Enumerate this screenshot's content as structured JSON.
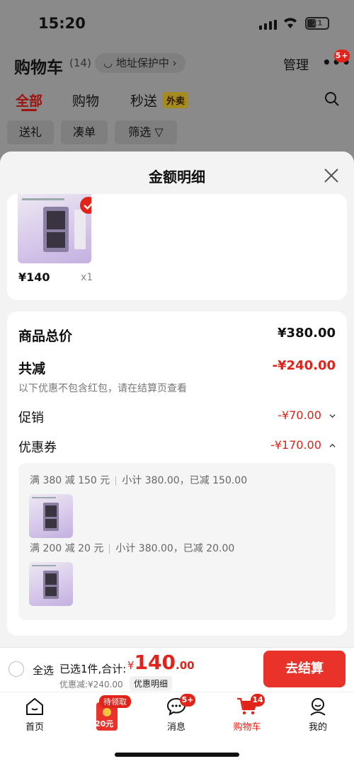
{
  "status_bar": {
    "time": "15:20",
    "battery": "21"
  },
  "header": {
    "title": "购物车",
    "count": "(14)",
    "address_protect": "地址保护中",
    "manage": "管理",
    "more_badge": "5+"
  },
  "tabs": [
    {
      "label": "全部"
    },
    {
      "label": "购物"
    },
    {
      "label": "秒送"
    }
  ],
  "waimai_tag": "外卖",
  "chips": [
    {
      "label": "送礼"
    },
    {
      "label": "凑单"
    },
    {
      "label": "筛选"
    }
  ],
  "sheet": {
    "title": "金额明细",
    "product": {
      "price": "¥140",
      "qty": "x1"
    },
    "summary": {
      "total_label": "商品总价",
      "total_value": "¥380.00",
      "reduce_label": "共减",
      "reduce_value": "-¥240.00",
      "note": "以下优惠不包含红包，请在结算页查看",
      "promo_label": "促销",
      "promo_value": "-¥70.00",
      "coupon_label": "优惠券",
      "coupon_value": "-¥170.00"
    },
    "coupons": [
      {
        "rule": "满 380 减 150 元",
        "detail": "小计 380.00，已减 150.00"
      },
      {
        "rule": "满 200 减 20 元",
        "detail": "小计 380.00，已减 20.00"
      }
    ]
  },
  "bottom_bar": {
    "select_all": "全选",
    "selected_text": "已选1件,合计:",
    "yen": "¥",
    "total_int": "140",
    "total_dec": ".00",
    "discount": "优惠减:¥240.00",
    "detail_tag": "优惠明细",
    "checkout": "去结算"
  },
  "nav": {
    "home": "首页",
    "coupon_pill": "待领取",
    "coupon_amount": "20元",
    "messages": "消息",
    "messages_badge": "5+",
    "cart": "购物车",
    "cart_badge": "14",
    "mine": "我的"
  },
  "colors": {
    "accent": "#e2231a",
    "checkout": "#e8322a"
  }
}
